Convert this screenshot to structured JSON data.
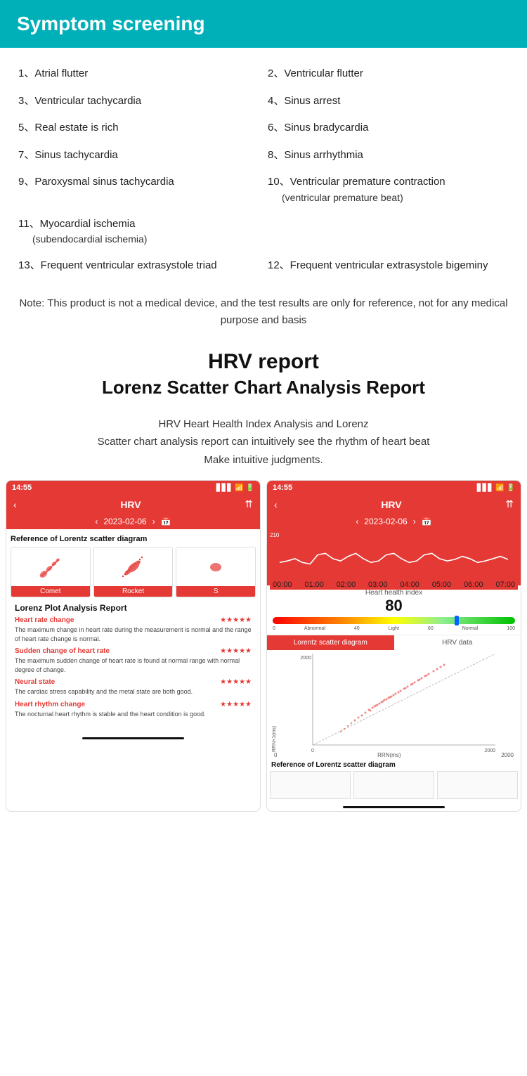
{
  "header": {
    "title": "Symptom screening",
    "bg_color": "#00B0B9"
  },
  "symptoms": [
    {
      "number": "1、",
      "text": "Atrial flutter",
      "sub": null
    },
    {
      "number": "2、",
      "text": "Ventricular flutter",
      "sub": null
    },
    {
      "number": "3、",
      "text": "Ventricular tachycardia",
      "sub": null
    },
    {
      "number": "4、",
      "text": "Sinus arrest",
      "sub": null
    },
    {
      "number": "5、",
      "text": "Real estate is rich",
      "sub": null
    },
    {
      "number": "6、",
      "text": "Sinus bradycardia",
      "sub": null
    },
    {
      "number": "7、",
      "text": "Sinus tachycardia",
      "sub": null
    },
    {
      "number": "8、",
      "text": "Sinus arrhythmia",
      "sub": null
    },
    {
      "number": "9、",
      "text": "Paroxysmal sinus tachycardia",
      "sub": null
    },
    {
      "number": "10、",
      "text": "Ventricular premature contraction",
      "sub": "(ventricular premature beat)"
    },
    {
      "number": "11、",
      "text": "Myocardial ischemia",
      "sub": "(subendocardial ischemia)"
    },
    {
      "number": "13、",
      "text": "Frequent ventricular extrasystole triad",
      "sub": null
    },
    {
      "number": "12、",
      "text": "Frequent ventricular extrasystole bigeminy",
      "sub": null
    }
  ],
  "note": {
    "text": "Note: This product is not a medical device, and the test results are only for reference, not for any medical purpose and basis"
  },
  "hrv_report": {
    "title": "HRV report",
    "subtitle": "Lorenz Scatter Chart Analysis Report",
    "description": "HRV Heart Health Index Analysis and Lorenz\nScatter chart analysis report can intuitively see the rhythm of heart beat\nMake intuitive judgments."
  },
  "phone_left": {
    "status_time": "14:55",
    "nav_title": "HRV",
    "date": "2023-02-06",
    "scatter_label": "Reference of Lorentz scatter diagram",
    "scatter_items": [
      {
        "label": "Comet"
      },
      {
        "label": "Rocket"
      },
      {
        "label": "S"
      }
    ],
    "analysis_title": "Lorenz Plot Analysis Report",
    "metrics": [
      {
        "name": "Heart rate change",
        "stars": "★★★★★",
        "desc": "The maximum change in heart rate during the measurement is normal and the range of heart rate change is normal."
      },
      {
        "name": "Sudden change of heart rate",
        "stars": "★★★★★",
        "desc": "The maximum sudden change of heart rate is found at normal range with normal degree of change."
      },
      {
        "name": "Neural state",
        "stars": "★★★★★",
        "desc": "The cardiac stress capability and the metal state are both good."
      },
      {
        "name": "Heart rhythm change",
        "stars": "★★★★★",
        "desc": "The nocturnal heart rhythm is stable and the heart condition is good."
      }
    ]
  },
  "phone_right": {
    "status_time": "14:55",
    "nav_title": "HRV",
    "date": "2023-02-06",
    "waveform_y": "210",
    "waveform_x_labels": [
      "00:00",
      "01:00",
      "02:00",
      "03:00",
      "04:00",
      "05:00",
      "06:00",
      "07:00"
    ],
    "health_label": "Heart health index",
    "health_number": "80",
    "bar_labels": [
      "0",
      "Abnormal",
      "40",
      "Light",
      "60",
      "Normal",
      "100"
    ],
    "tabs": [
      "Lorentz scatter diagram",
      "HRV data"
    ],
    "scatter_y_label": "RRN+1(ms)",
    "scatter_x_label": "RRN(ms)",
    "scatter_x_range": "2000",
    "scatter_y_range": "2000",
    "ref_label": "Reference of Lorentz scatter diagram"
  }
}
